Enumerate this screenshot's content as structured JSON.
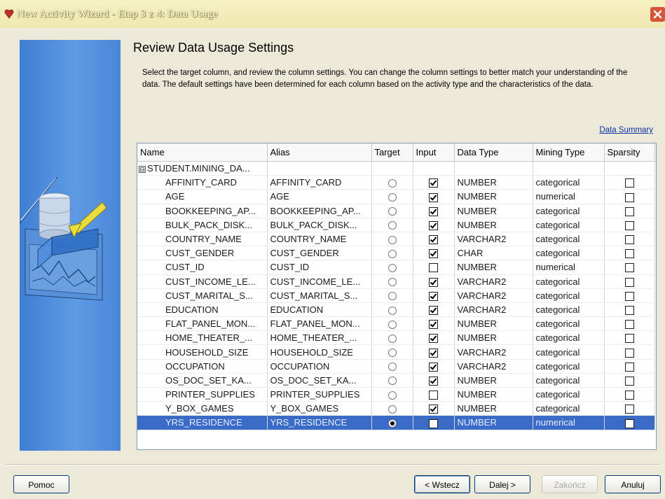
{
  "window": {
    "title": "New Activity Wizard - Etap 3 z 4: Data Usage"
  },
  "page": {
    "heading": "Review Data Usage Settings",
    "description": "Select the target column, and review the column settings. You can change the column settings to better match your understanding of the data. The default settings have been determined for each column based on the activity type and the characteristics of the data.",
    "summary_link": "Data Summary"
  },
  "table": {
    "columns": [
      "Name",
      "Alias",
      "Target",
      "Input",
      "Data Type",
      "Mining Type",
      "Sparsity"
    ],
    "group": {
      "expander": "⊟",
      "name": "STUDENT.MINING_DA..."
    },
    "rows": [
      {
        "name": "AFFINITY_CARD",
        "alias": "AFFINITY_CARD",
        "target": false,
        "input": true,
        "data_type": "NUMBER",
        "mining_type": "categorical",
        "sparsity": false
      },
      {
        "name": "AGE",
        "alias": "AGE",
        "target": false,
        "input": true,
        "data_type": "NUMBER",
        "mining_type": "numerical",
        "sparsity": false
      },
      {
        "name": "BOOKKEEPING_AP...",
        "alias": "BOOKKEEPING_AP...",
        "target": false,
        "input": true,
        "data_type": "NUMBER",
        "mining_type": "categorical",
        "sparsity": false
      },
      {
        "name": "BULK_PACK_DISK...",
        "alias": "BULK_PACK_DISK...",
        "target": false,
        "input": true,
        "data_type": "NUMBER",
        "mining_type": "categorical",
        "sparsity": false
      },
      {
        "name": "COUNTRY_NAME",
        "alias": "COUNTRY_NAME",
        "target": false,
        "input": true,
        "data_type": "VARCHAR2",
        "mining_type": "categorical",
        "sparsity": false
      },
      {
        "name": "CUST_GENDER",
        "alias": "CUST_GENDER",
        "target": false,
        "input": true,
        "data_type": "CHAR",
        "mining_type": "categorical",
        "sparsity": false
      },
      {
        "name": "CUST_ID",
        "alias": "CUST_ID",
        "target": false,
        "input": false,
        "data_type": "NUMBER",
        "mining_type": "numerical",
        "sparsity": false
      },
      {
        "name": "CUST_INCOME_LE...",
        "alias": "CUST_INCOME_LE...",
        "target": false,
        "input": true,
        "data_type": "VARCHAR2",
        "mining_type": "categorical",
        "sparsity": false
      },
      {
        "name": "CUST_MARITAL_S...",
        "alias": "CUST_MARITAL_S...",
        "target": false,
        "input": true,
        "data_type": "VARCHAR2",
        "mining_type": "categorical",
        "sparsity": false
      },
      {
        "name": "EDUCATION",
        "alias": "EDUCATION",
        "target": false,
        "input": true,
        "data_type": "VARCHAR2",
        "mining_type": "categorical",
        "sparsity": false
      },
      {
        "name": "FLAT_PANEL_MON...",
        "alias": "FLAT_PANEL_MON...",
        "target": false,
        "input": true,
        "data_type": "NUMBER",
        "mining_type": "categorical",
        "sparsity": false
      },
      {
        "name": "HOME_THEATER_...",
        "alias": "HOME_THEATER_...",
        "target": false,
        "input": true,
        "data_type": "NUMBER",
        "mining_type": "categorical",
        "sparsity": false
      },
      {
        "name": "HOUSEHOLD_SIZE",
        "alias": "HOUSEHOLD_SIZE",
        "target": false,
        "input": true,
        "data_type": "VARCHAR2",
        "mining_type": "categorical",
        "sparsity": false
      },
      {
        "name": "OCCUPATION",
        "alias": "OCCUPATION",
        "target": false,
        "input": true,
        "data_type": "VARCHAR2",
        "mining_type": "categorical",
        "sparsity": false
      },
      {
        "name": "OS_DOC_SET_KA...",
        "alias": "OS_DOC_SET_KA...",
        "target": false,
        "input": true,
        "data_type": "NUMBER",
        "mining_type": "categorical",
        "sparsity": false
      },
      {
        "name": "PRINTER_SUPPLIES",
        "alias": "PRINTER_SUPPLIES",
        "target": false,
        "input": false,
        "data_type": "NUMBER",
        "mining_type": "categorical",
        "sparsity": false
      },
      {
        "name": "Y_BOX_GAMES",
        "alias": "Y_BOX_GAMES",
        "target": false,
        "input": true,
        "data_type": "NUMBER",
        "mining_type": "categorical",
        "sparsity": false
      },
      {
        "name": "YRS_RESIDENCE",
        "alias": "YRS_RESIDENCE",
        "target": true,
        "input": false,
        "data_type": "NUMBER",
        "mining_type": "numerical",
        "sparsity": false,
        "selected": true
      }
    ]
  },
  "buttons": {
    "help": "Pomoc",
    "back": "< Wstecz",
    "next": "Dalej >",
    "finish": "Zakończ",
    "cancel": "Anuluj"
  },
  "colors": {
    "selection": "#3a6cc7",
    "side_panel": "#4a86d8",
    "link": "#0a31a6",
    "close": "#d6553a"
  },
  "icons": {
    "app": "oracle-wizard-icon",
    "close": "close-icon",
    "side_art": "database-mining-illustration"
  }
}
